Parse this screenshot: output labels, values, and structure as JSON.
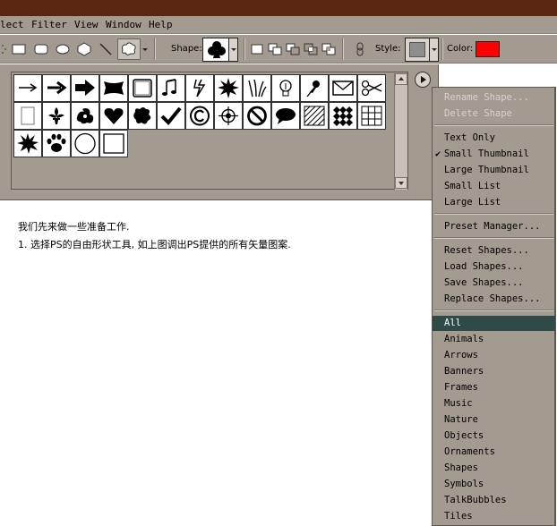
{
  "menu": {
    "items": [
      {
        "label": "lect"
      },
      {
        "label": "Filter"
      },
      {
        "label": "View"
      },
      {
        "label": "Window"
      },
      {
        "label": "Help"
      }
    ]
  },
  "toolbar": {
    "shape_label": "Shape:",
    "style_label": "Style:",
    "color_label": "Color:",
    "color_value": "#ff0000",
    "tools": [
      "rectangle-tool",
      "rounded-rectangle-tool",
      "ellipse-tool",
      "polygon-tool",
      "line-tool",
      "custom-shape-tool"
    ],
    "modes": [
      "create-new-layer",
      "add-to-area",
      "subtract-area",
      "intersect-area",
      "exclude-overlap"
    ]
  },
  "shapes": [
    "arrow-thin",
    "arrow",
    "arrow-bold",
    "banner",
    "frame",
    "music-notes",
    "lightning",
    "starburst",
    "grass",
    "lightbulb",
    "pushpin",
    "envelope",
    "scissors",
    "blank-frame",
    "fleur-de-lis",
    "ornament",
    "heart",
    "blob",
    "checkmark",
    "copyright",
    "target",
    "no-sign",
    "talk-bubble",
    "hatched-square",
    "diamond-grid",
    "grid",
    "splat",
    "paw-print",
    "circle-frame",
    "square-frame"
  ],
  "dropdown": {
    "groups": [
      [
        {
          "label": "Rename Shape...",
          "disabled": true
        },
        {
          "label": "Delete Shape",
          "disabled": true
        }
      ],
      [
        {
          "label": "Text Only"
        },
        {
          "label": "Small Thumbnail",
          "checked": true
        },
        {
          "label": "Large Thumbnail"
        },
        {
          "label": "Small List"
        },
        {
          "label": "Large List"
        }
      ],
      [
        {
          "label": "Preset Manager..."
        }
      ],
      [
        {
          "label": "Reset Shapes..."
        },
        {
          "label": "Load Shapes..."
        },
        {
          "label": "Save Shapes..."
        },
        {
          "label": "Replace Shapes..."
        }
      ],
      [
        {
          "label": "All",
          "active": true
        },
        {
          "label": "Animals"
        },
        {
          "label": "Arrows"
        },
        {
          "label": "Banners"
        },
        {
          "label": "Frames"
        },
        {
          "label": "Music"
        },
        {
          "label": "Nature"
        },
        {
          "label": "Objects"
        },
        {
          "label": "Ornaments"
        },
        {
          "label": "Shapes"
        },
        {
          "label": "Symbols"
        },
        {
          "label": "TalkBubbles"
        },
        {
          "label": "Tiles"
        }
      ]
    ]
  },
  "content": {
    "line1": "我们先来做一些准备工作.",
    "line2": "1. 选择PS的自由形状工具, 如上图调出PS提供的所有矢量图案."
  }
}
